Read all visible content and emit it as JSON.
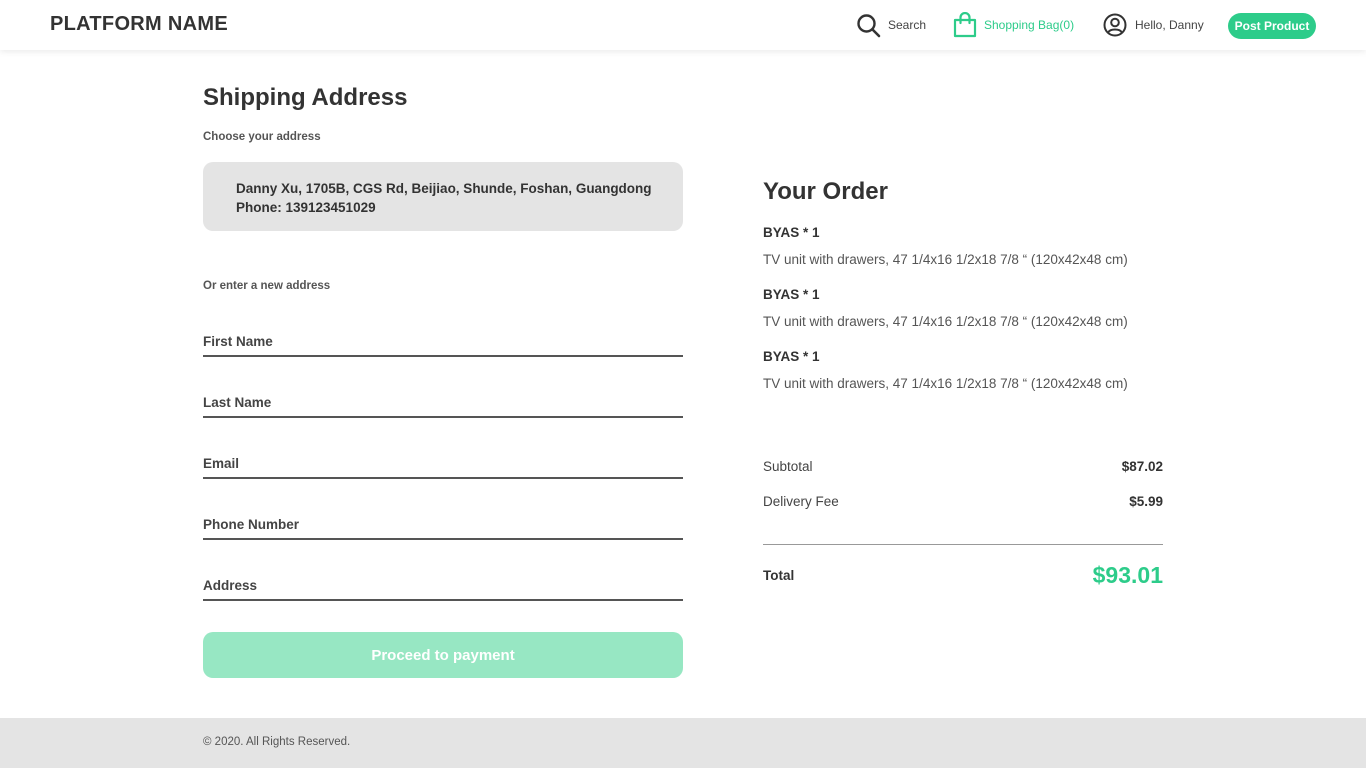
{
  "header": {
    "brand": "PLATFORM NAME",
    "search_label": "Search",
    "bag_label": "Shopping Bag(0)",
    "user_greeting": "Hello, Danny",
    "post_button": "Post Product"
  },
  "shipping": {
    "title": "Shipping Address",
    "choose_label": "Choose your address",
    "saved_address": {
      "line1": "Danny Xu, 1705B, CGS Rd, Beijiao, Shunde, Foshan, Guangdong",
      "line2": "Phone: 139123451029"
    },
    "new_address_label": "Or enter a new address",
    "fields": {
      "first_name": {
        "placeholder": "First Name",
        "value": ""
      },
      "last_name": {
        "placeholder": "Last Name",
        "value": ""
      },
      "email": {
        "placeholder": "Email",
        "value": ""
      },
      "phone": {
        "placeholder": "Phone Number",
        "value": ""
      },
      "address": {
        "placeholder": "Address",
        "value": ""
      }
    },
    "proceed_button": "Proceed to payment"
  },
  "order": {
    "title": "Your Order",
    "items": [
      {
        "name": "BYAS * 1",
        "description": "TV unit with drawers, 47 1/4x16 1/2x18 7/8 “ (120x42x48 cm)"
      },
      {
        "name": "BYAS * 1",
        "description": "TV unit with drawers, 47 1/4x16 1/2x18 7/8 “ (120x42x48 cm)"
      },
      {
        "name": "BYAS * 1",
        "description": "TV unit with drawers, 47 1/4x16 1/2x18 7/8 “ (120x42x48 cm)"
      }
    ],
    "subtotal_label": "Subtotal",
    "subtotal_value": "$87.02",
    "delivery_label": "Delivery Fee",
    "delivery_value": "$5.99",
    "total_label": "Total",
    "total_value": "$93.01"
  },
  "footer": {
    "copyright": "© 2020. All Rights Reserved."
  },
  "icons": {
    "search": "search-icon",
    "bag": "shopping-bag-icon",
    "user": "user-circle-icon"
  },
  "colors": {
    "accent": "#2dcc8a",
    "accent_disabled": "#97e7c3",
    "card_bg": "#e4e4e4",
    "footer_bg": "#e4e4e4"
  }
}
